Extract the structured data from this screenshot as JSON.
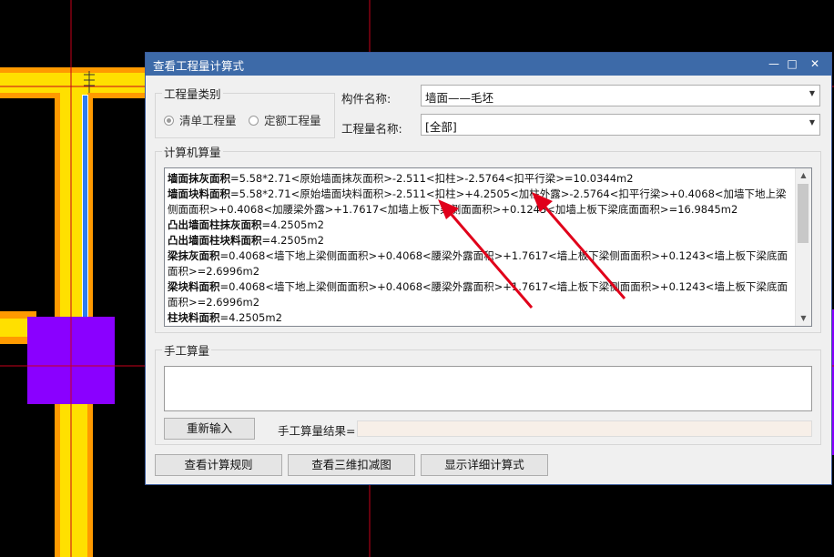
{
  "window": {
    "title": "查看工程量计算式",
    "minimize_icon": "minimize-icon",
    "maximize_icon": "maximize-icon",
    "close_icon": "close-icon"
  },
  "category": {
    "label": "工程量类别",
    "options": [
      {
        "label": "清单工程量",
        "checked": true
      },
      {
        "label": "定额工程量",
        "checked": false
      }
    ]
  },
  "component": {
    "label": "构件名称:",
    "value": "墙面——毛坯"
  },
  "quantity": {
    "label": "工程量名称:",
    "value": "[全部]"
  },
  "computed": {
    "label": "计算机算量",
    "lines": [
      {
        "name": "墙面抹灰面积",
        "formula": "=5.58*2.71<原始墙面抹灰面积>-2.511<扣柱>-2.5764<扣平行梁>=10.0344m2"
      },
      {
        "name": "墙面块料面积",
        "formula": "=5.58*2.71<原始墙面块料面积>-2.511<扣柱>+4.2505<加柱外露>-2.5764<扣平行梁>+0.4068<加墙下地上梁侧面面积>+0.4068<加腰梁外露>+1.7617<加墙上板下梁侧面面积>+0.1243<加墙上板下梁底面面积>=16.9845m2"
      },
      {
        "name": "凸出墙面柱抹灰面积",
        "formula": "=4.2505m2"
      },
      {
        "name": "凸出墙面柱块料面积",
        "formula": "=4.2505m2"
      },
      {
        "name": "梁抹灰面积",
        "formula": "=0.4068<墙下地上梁侧面面积>+0.4068<腰梁外露面积>+1.7617<墙上板下梁侧面面积>+0.1243<墙上板下梁底面面积>=2.6996m2"
      },
      {
        "name": "梁块料面积",
        "formula": "=0.4068<墙下地上梁侧面面积>+0.4068<腰梁外露面积>+1.7617<墙上板下梁侧面面积>+0.1243<墙上板下梁底面面积>=2.6996m2"
      },
      {
        "name": "柱块料面积",
        "formula": "=4.2505m2"
      }
    ]
  },
  "manual": {
    "label": "手工算量",
    "reenter": "重新输入",
    "result_label": "手工算量结果=",
    "result_value": ""
  },
  "buttons": {
    "rules": "查看计算规则",
    "three_d": "查看三维扣减图",
    "detail": "显示详细计算式"
  },
  "colors": {
    "titlebar": "#3d6aa8",
    "cad_background": "#000000",
    "wall_yellow": "#ffe000",
    "wall_orange": "#ff9a00",
    "column_purple": "#8a00ff",
    "annotation_red": "#e0001a"
  }
}
